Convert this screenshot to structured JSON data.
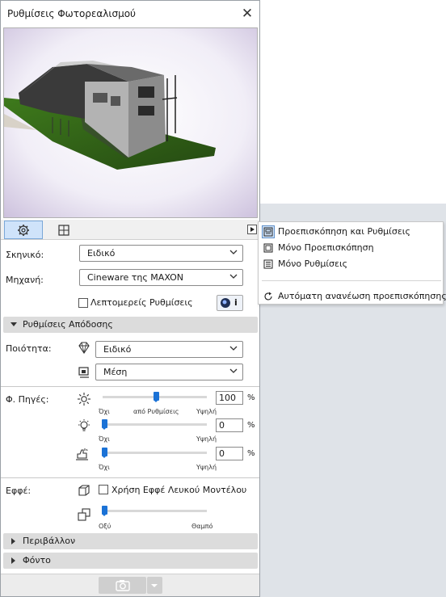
{
  "window": {
    "title": "Ρυθμίσεις Φωτορεαλισμού",
    "close_icon": "close-icon"
  },
  "tabs": [
    {
      "name": "settings",
      "icon": "gear-icon",
      "active": true
    },
    {
      "name": "preview",
      "icon": "viewport-icon",
      "active": false
    }
  ],
  "form": {
    "scene_label": "Σκηνικό:",
    "scene_value": "Ειδικό",
    "engine_label": "Μηχανή:",
    "engine_value": "Cineware της MAXON",
    "detailed_label": "Λεπτομερείς Ρυθμίσεις",
    "detailed_checked": false,
    "render_info_button": "i"
  },
  "render_section": {
    "title": "Ρυθμίσεις Απόδοσης",
    "quality_label": "Ποιότητα:",
    "quality_value": "Ειδικό",
    "quality2_value": "Μέση"
  },
  "lights": {
    "label": "Φ. Πηγές:",
    "sun": {
      "value": "100",
      "unit": "%",
      "level": 0.5,
      "min": "Όχι",
      "mid": "από Ρυθμίσεις",
      "max": "Υψηλή"
    },
    "lamp": {
      "value": "0",
      "unit": "%",
      "level": 0.0,
      "min": "Όχι",
      "max": "Υψηλή"
    },
    "physical": {
      "value": "0",
      "unit": "%",
      "level": 0.0,
      "min": "Όχι",
      "max": "Υψηλή"
    }
  },
  "effects": {
    "label": "Εφφέ:",
    "white_model_label": "Χρήση Εφφέ Λευκού Μοντέλου",
    "white_model_checked": false,
    "blur": {
      "level": 0.0,
      "min": "Οξύ",
      "max": "Θαμπό"
    }
  },
  "collapsed_sections": {
    "environment": "Περιβάλλον",
    "background": "Φόντο"
  },
  "context_menu": {
    "items": [
      {
        "label": "Προεπισκόπηση και Ρυθμίσεις",
        "icon": "preview-settings-icon",
        "selected": true
      },
      {
        "label": "Μόνο Προεπισκόπηση",
        "icon": "preview-only-icon",
        "selected": false
      },
      {
        "label": "Μόνο Ρυθμίσεις",
        "icon": "settings-only-icon",
        "selected": false
      }
    ],
    "auto_refresh": {
      "label": "Αυτόματη ανανέωση προεπισκόπησης",
      "icon": "refresh-icon"
    }
  },
  "colors": {
    "accent": "#1b72d6",
    "section_bg": "#dcdcdc",
    "tab_active": "#cfe3fa",
    "workspace": "#dfe3e8"
  }
}
